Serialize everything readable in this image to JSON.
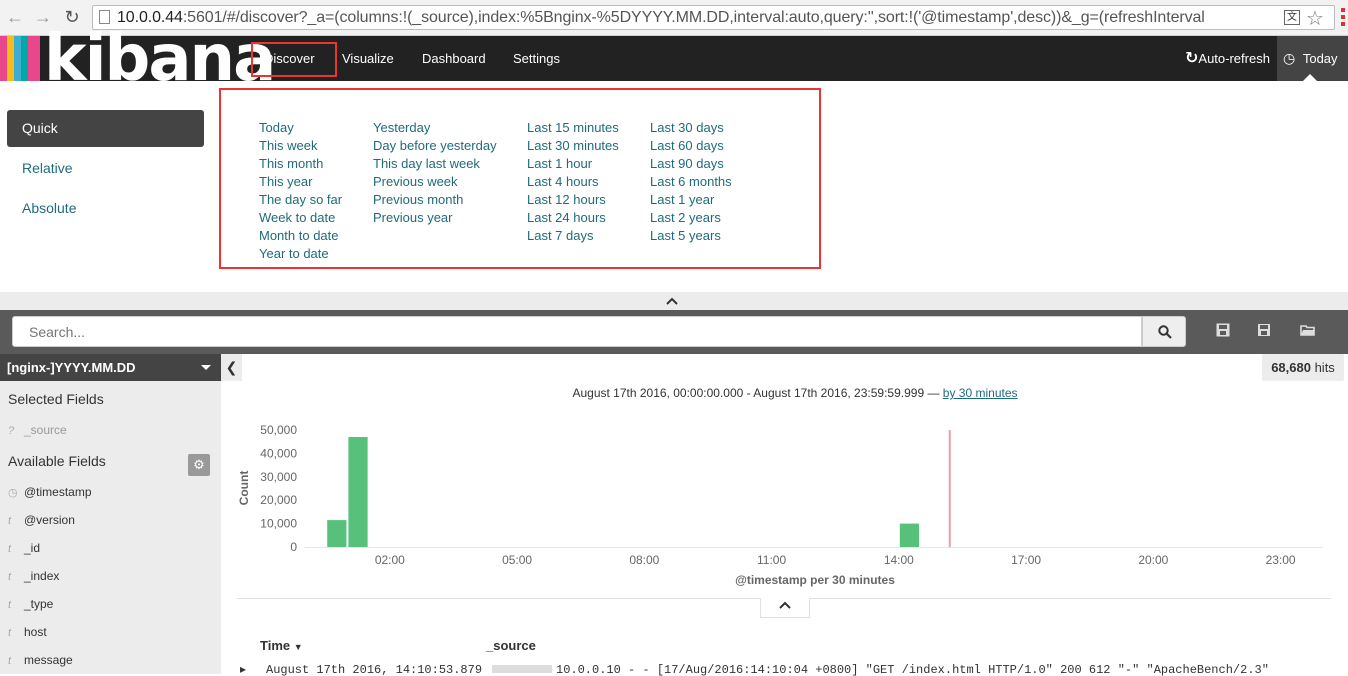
{
  "browser": {
    "url_host": "10.0.0.44",
    "url_rest": ":5601/#/discover?_a=(columns:!(_source),index:%5Bnginx-%5DYYYY.MM.DD,interval:auto,query:'',sort:!('@timestamp',desc))&_g=(refreshInterval"
  },
  "navbar": {
    "logo_text": "kibana",
    "items": [
      "Discover",
      "Visualize",
      "Dashboard",
      "Settings"
    ],
    "auto_refresh": "Auto-refresh",
    "today": "Today"
  },
  "picker": {
    "tabs": [
      "Quick",
      "Relative",
      "Absolute"
    ],
    "columns": [
      [
        "Today",
        "This week",
        "This month",
        "This year",
        "The day so far",
        "Week to date",
        "Month to date",
        "Year to date"
      ],
      [
        "Yesterday",
        "Day before yesterday",
        "This day last week",
        "Previous week",
        "Previous month",
        "Previous year"
      ],
      [
        "Last 15 minutes",
        "Last 30 minutes",
        "Last 1 hour",
        "Last 4 hours",
        "Last 12 hours",
        "Last 24 hours",
        "Last 7 days"
      ],
      [
        "Last 30 days",
        "Last 60 days",
        "Last 90 days",
        "Last 6 months",
        "Last 1 year",
        "Last 2 years",
        "Last 5 years"
      ]
    ]
  },
  "search": {
    "placeholder": "Search..."
  },
  "sidebar": {
    "index_pattern": "[nginx-]YYYY.MM.DD",
    "selected_heading": "Selected Fields",
    "selected_fields": [
      {
        "type": "?",
        "name": "_source"
      }
    ],
    "available_heading": "Available Fields",
    "available_fields": [
      {
        "type": "clock",
        "name": "@timestamp"
      },
      {
        "type": "t",
        "name": "@version"
      },
      {
        "type": "t",
        "name": "_id"
      },
      {
        "type": "t",
        "name": "_index"
      },
      {
        "type": "t",
        "name": "_type"
      },
      {
        "type": "t",
        "name": "host"
      },
      {
        "type": "t",
        "name": "message"
      }
    ]
  },
  "main": {
    "hits_count": "68,680",
    "hits_label": "hits",
    "range_text": "August 17th 2016, 00:00:00.000 - August 17th 2016, 23:59:59.999 —",
    "interval_link": "by 30 minutes",
    "table_headers": [
      "Time",
      "_source"
    ],
    "row_time": "August 17th 2016, 14:10:53.879",
    "row_source": "10.0.0.10 - - [17/Aug/2016:14:10:04 +0800] \"GET /index.html HTTP/1.0\" 200 612 \"-\" \"ApacheBench/2.3\""
  },
  "colors": {
    "bar": "#57c17b",
    "marker": "#e8a0a8",
    "accent": "#1f6b7a"
  },
  "chart_data": {
    "type": "bar",
    "x": [
      "00:30",
      "01:00",
      "14:00"
    ],
    "values": [
      11500,
      47000,
      10000
    ],
    "x_tick_labels": [
      "02:00",
      "05:00",
      "08:00",
      "11:00",
      "14:00",
      "17:00",
      "20:00",
      "23:00"
    ],
    "y_tick_labels": [
      "0",
      "10,000",
      "20,000",
      "30,000",
      "40,000",
      "50,000"
    ],
    "ylabel": "Count",
    "xlabel": "@timestamp per 30 minutes",
    "ylim": [
      0,
      50000
    ],
    "xlim_hours": [
      0,
      24
    ],
    "marker_hour": 15.2
  }
}
